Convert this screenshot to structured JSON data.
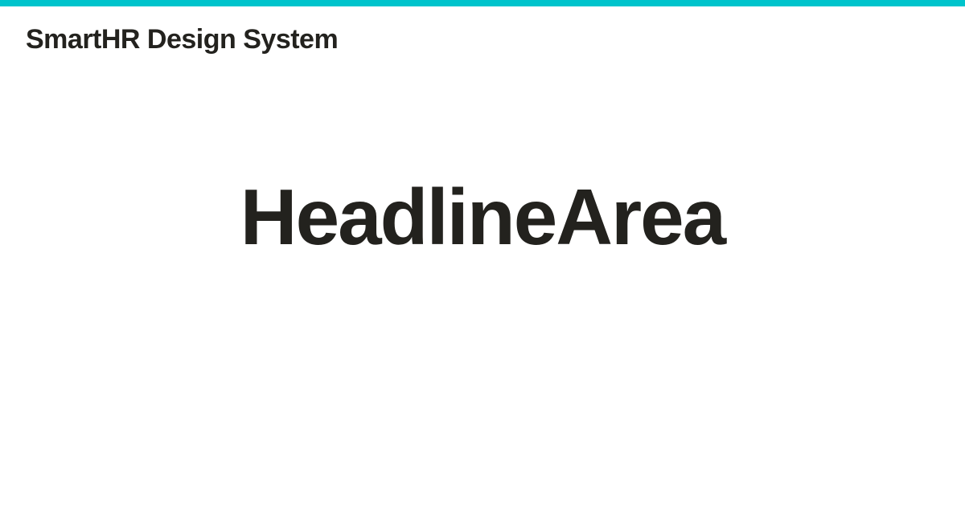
{
  "site": {
    "title": "SmartHR Design System"
  },
  "page": {
    "headline": "HeadlineArea"
  },
  "colors": {
    "accent": "#00c4cc",
    "text": "#23221e",
    "background": "#ffffff"
  }
}
